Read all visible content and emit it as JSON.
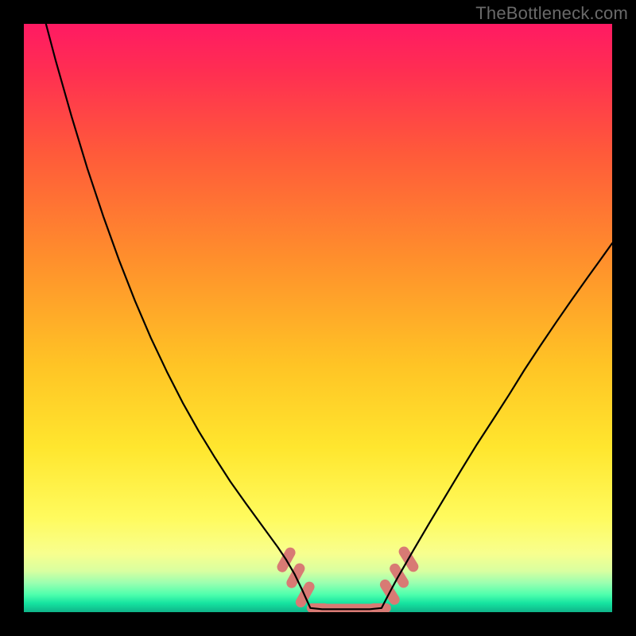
{
  "watermark": "TheBottleneck.com",
  "colors": {
    "frame": "#000000",
    "curve": "#000000",
    "beads": "#d87a74"
  },
  "chart_data": {
    "type": "line",
    "title": "",
    "xlabel": "",
    "ylabel": "",
    "xlim": [
      0,
      100
    ],
    "ylim": [
      0,
      100
    ],
    "grid": false,
    "legend": false,
    "series": [
      {
        "name": "left-branch",
        "x": [
          0.0,
          2.7,
          5.4,
          8.1,
          10.8,
          13.5,
          16.2,
          18.9,
          21.6,
          24.3,
          27.0,
          29.7,
          32.4,
          35.1,
          37.8,
          40.5,
          43.2,
          44.6,
          46.0,
          47.3,
          48.7
        ],
        "y": [
          115.0,
          104.0,
          93.8,
          84.3,
          75.4,
          67.3,
          59.8,
          52.9,
          46.6,
          40.9,
          35.6,
          30.8,
          26.4,
          22.2,
          18.4,
          14.7,
          11.0,
          8.9,
          6.5,
          3.8,
          0.7
        ]
      },
      {
        "name": "valley-floor",
        "x": [
          48.7,
          50.7,
          52.7,
          54.7,
          56.8,
          58.8,
          60.8
        ],
        "y": [
          0.7,
          0.5,
          0.5,
          0.5,
          0.5,
          0.5,
          0.7
        ]
      },
      {
        "name": "right-branch",
        "x": [
          60.8,
          62.2,
          63.5,
          66.2,
          68.9,
          71.6,
          74.3,
          77.0,
          79.8,
          82.5,
          85.1,
          87.8,
          90.5,
          93.2,
          95.9,
          98.0,
          100.0
        ],
        "y": [
          0.7,
          3.4,
          5.8,
          10.5,
          15.1,
          19.6,
          24.1,
          28.5,
          32.8,
          37.0,
          41.2,
          45.3,
          49.3,
          53.2,
          57.0,
          59.9,
          62.7
        ]
      }
    ],
    "markers": [
      {
        "name": "bead-left-1",
        "x": 44.6,
        "y": 8.9,
        "len": 2.8,
        "angle": -61
      },
      {
        "name": "bead-left-2",
        "x": 46.2,
        "y": 6.2,
        "len": 2.8,
        "angle": -61
      },
      {
        "name": "bead-left-3",
        "x": 47.8,
        "y": 3.0,
        "len": 3.0,
        "angle": -61
      },
      {
        "name": "bead-floor-1",
        "x": 50.0,
        "y": 0.7,
        "len": 2.2,
        "angle": 0
      },
      {
        "name": "bead-floor-2",
        "x": 52.2,
        "y": 0.6,
        "len": 2.2,
        "angle": 0
      },
      {
        "name": "bead-floor-3",
        "x": 54.3,
        "y": 0.6,
        "len": 2.2,
        "angle": 0
      },
      {
        "name": "bead-floor-4",
        "x": 56.5,
        "y": 0.6,
        "len": 2.2,
        "angle": 0
      },
      {
        "name": "bead-floor-5",
        "x": 58.6,
        "y": 0.6,
        "len": 2.2,
        "angle": 0
      },
      {
        "name": "bead-floor-6",
        "x": 60.5,
        "y": 0.7,
        "len": 2.2,
        "angle": 0
      },
      {
        "name": "bead-right-1",
        "x": 62.2,
        "y": 3.4,
        "len": 3.0,
        "angle": 58
      },
      {
        "name": "bead-right-2",
        "x": 63.8,
        "y": 6.2,
        "len": 2.8,
        "angle": 58
      },
      {
        "name": "bead-right-3",
        "x": 65.4,
        "y": 9.0,
        "len": 3.0,
        "angle": 58
      }
    ],
    "gradient_stops": [
      {
        "pct": 0,
        "color": "#ff1a63"
      },
      {
        "pct": 8,
        "color": "#ff2e52"
      },
      {
        "pct": 22,
        "color": "#ff5a3a"
      },
      {
        "pct": 40,
        "color": "#ff8f2c"
      },
      {
        "pct": 58,
        "color": "#ffc425"
      },
      {
        "pct": 72,
        "color": "#ffe62e"
      },
      {
        "pct": 84,
        "color": "#fffb5e"
      },
      {
        "pct": 90,
        "color": "#f8ff8e"
      },
      {
        "pct": 93,
        "color": "#d9ffa0"
      },
      {
        "pct": 95,
        "color": "#9cffb0"
      },
      {
        "pct": 97,
        "color": "#4fffad"
      },
      {
        "pct": 98.5,
        "color": "#15e3a0"
      },
      {
        "pct": 100,
        "color": "#0fb489"
      }
    ]
  }
}
